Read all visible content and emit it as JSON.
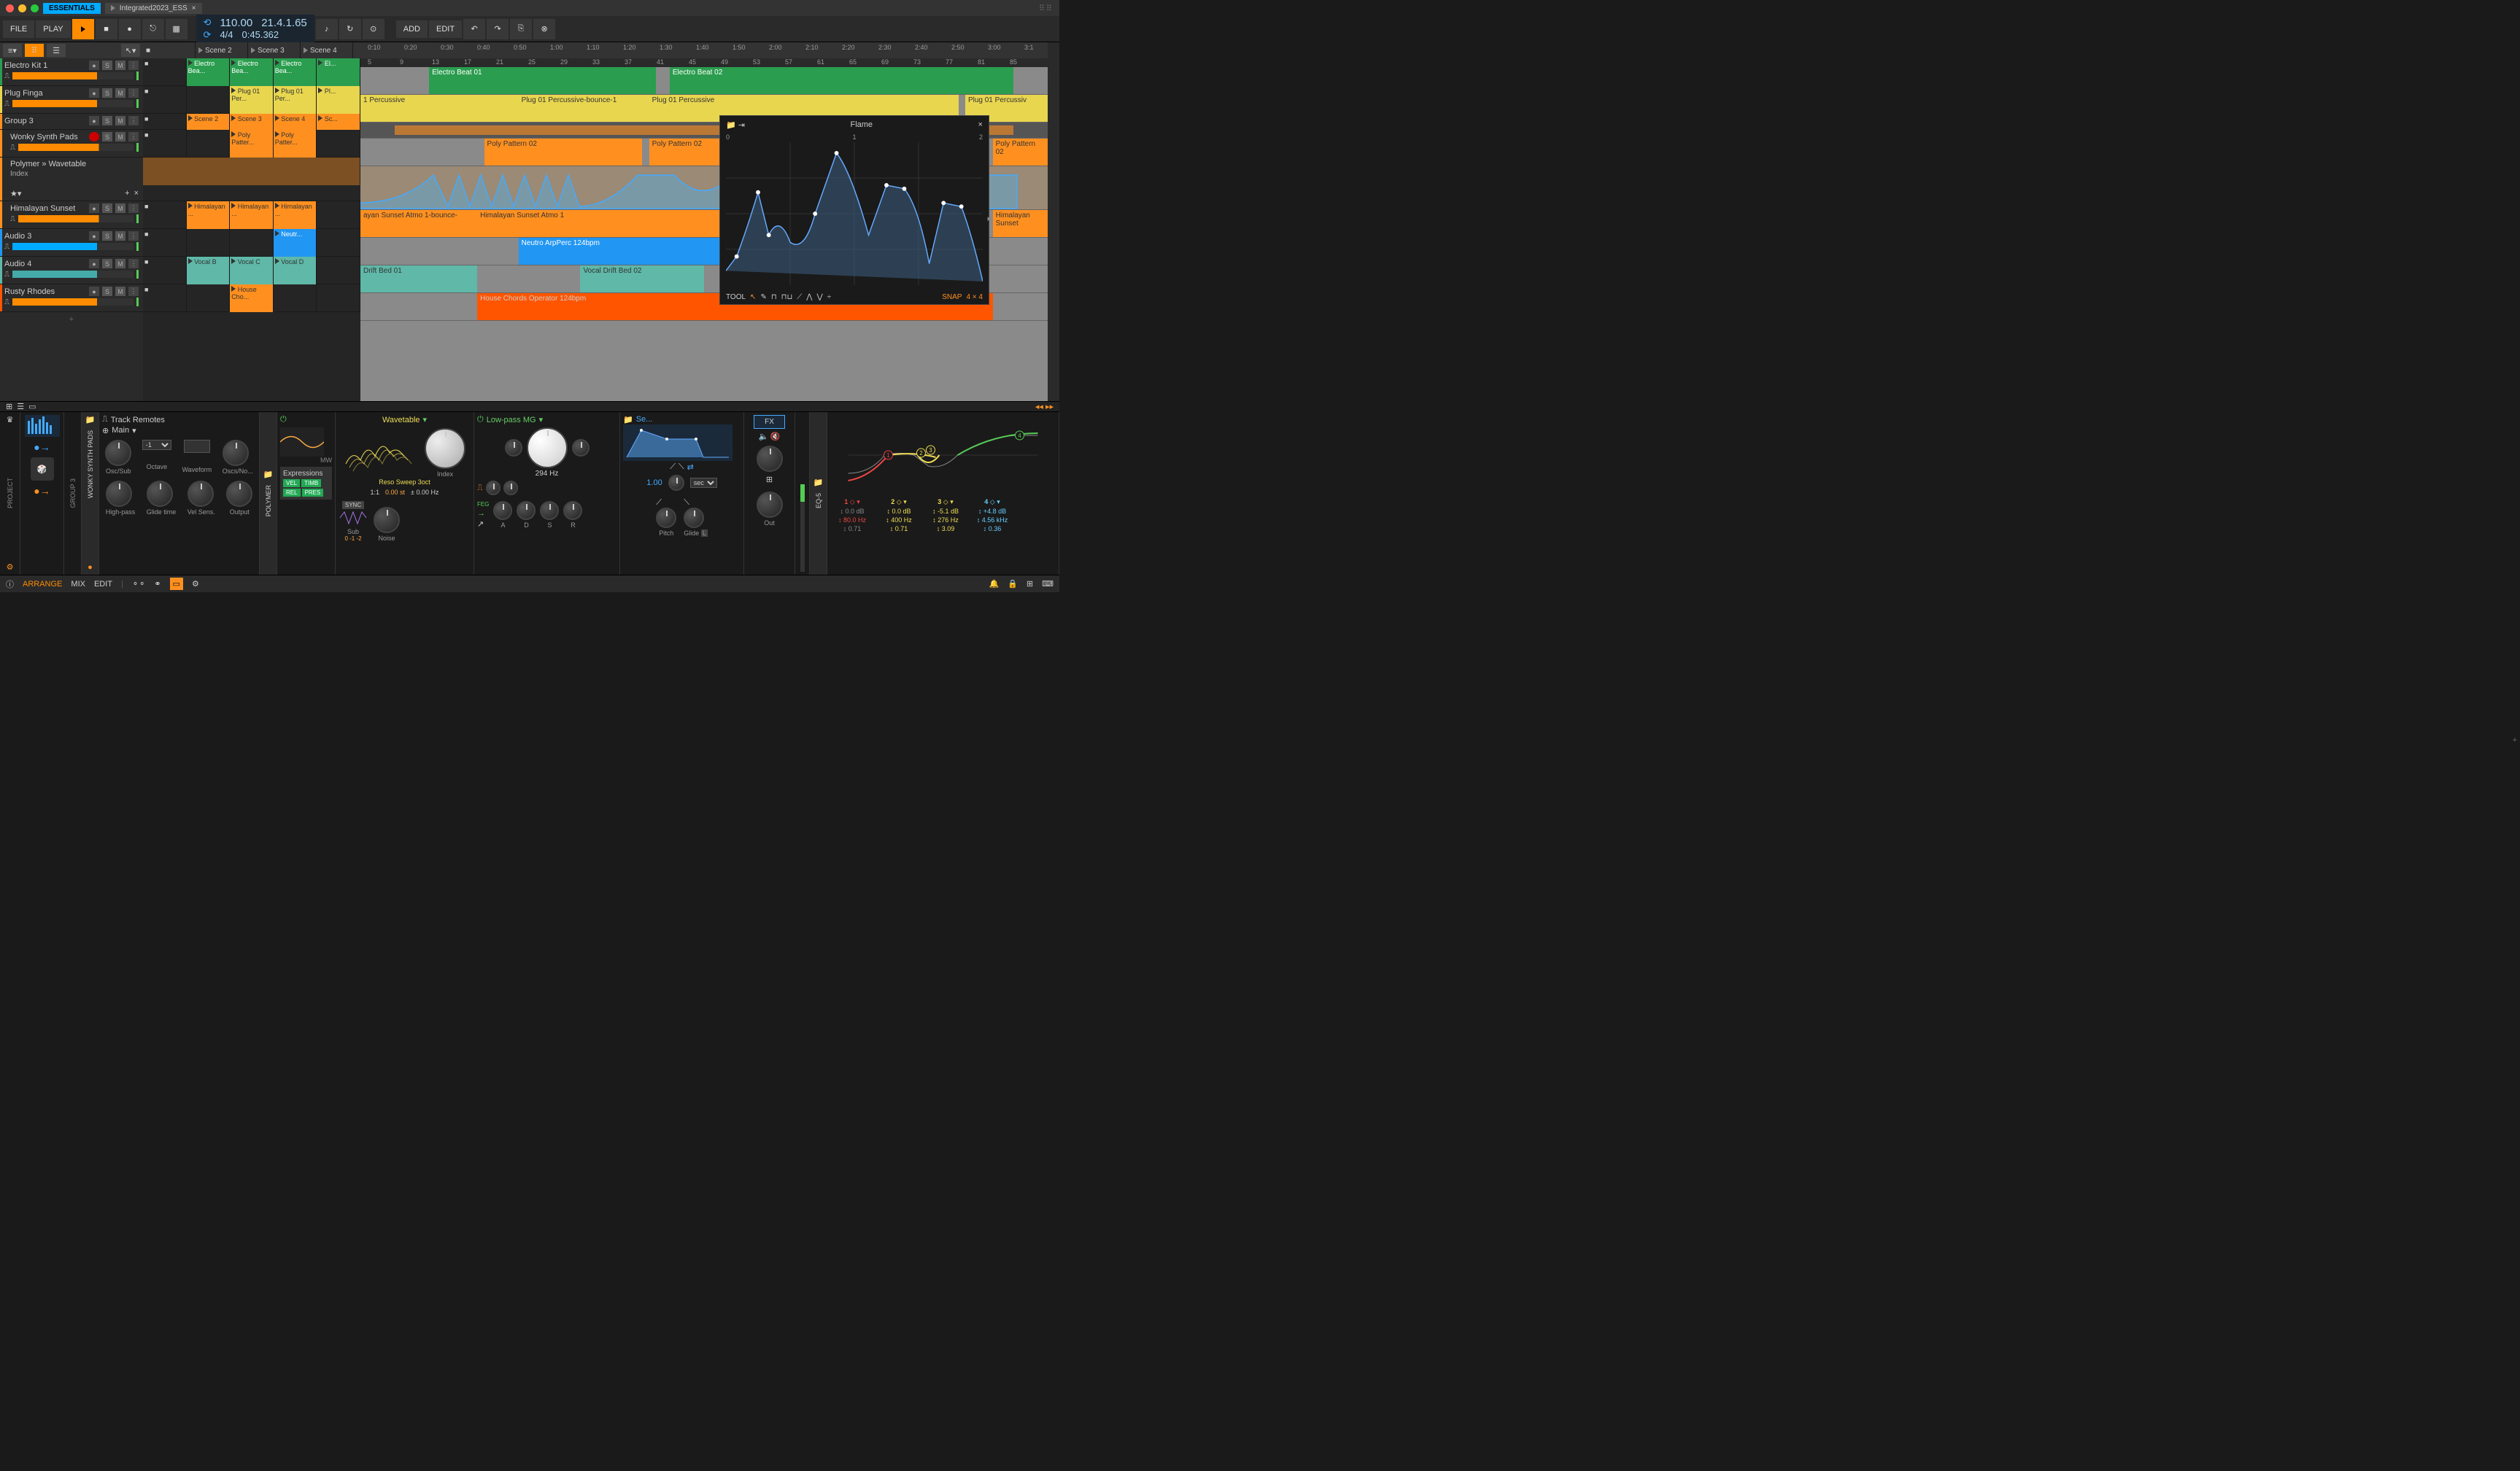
{
  "title_essentials": "ESSENTIALS",
  "doc_name": "Integrated2023_ESS",
  "toolbar": {
    "file": "FILE",
    "play": "PLAY",
    "add": "ADD",
    "edit": "EDIT"
  },
  "transport": {
    "tempo": "110.00",
    "sig": "4/4",
    "pos_bars": "21.4.1.65",
    "pos_time": "0:45.362"
  },
  "timeline_times": [
    "0:10",
    "0:20",
    "0:30",
    "0:40",
    "0:50",
    "1:00",
    "1:10",
    "1:20",
    "1:30",
    "1:40",
    "1:50",
    "2:00",
    "2:10",
    "2:20",
    "2:30",
    "2:40",
    "2:50",
    "3:00",
    "3:1"
  ],
  "timeline_bars": [
    "5",
    "9",
    "13",
    "17",
    "21",
    "25",
    "29",
    "33",
    "37",
    "41",
    "45",
    "49",
    "53",
    "57",
    "61",
    "65",
    "69",
    "73",
    "77",
    "81",
    "85"
  ],
  "scenes": [
    "Scene 2",
    "Scene 3",
    "Scene 4"
  ],
  "tracks": [
    {
      "name": "Electro Kit 1",
      "color": "#2a9d4f",
      "clips": [
        "Electro Bea...",
        "Electro Bea...",
        "Electro Bea...",
        "El..."
      ],
      "arr": [
        {
          "l": 10,
          "w": 33,
          "t": "Electro Beat 01"
        },
        {
          "l": 45,
          "w": 50,
          "t": "Electro Beat 02"
        }
      ]
    },
    {
      "name": "Plug Finga",
      "color": "#e8d64f",
      "clips": [
        "",
        "Plug 01 Per...",
        "Plug 01 Per...",
        "Pl..."
      ],
      "arr": [
        {
          "l": 0,
          "w": 23,
          "t": "1 Percussive"
        },
        {
          "l": 23,
          "w": 19,
          "t": "Plug 01 Percussive-bounce-1"
        },
        {
          "l": 42,
          "w": 45,
          "t": "Plug 01 Percussive"
        },
        {
          "l": 88,
          "w": 12,
          "t": "Plug 01 Percussiv"
        }
      ]
    },
    {
      "name": "Group 3",
      "color": "#ff9020",
      "group": true,
      "clips": [
        "Scene 2",
        "Scene 3",
        "Scene 4",
        "Sc..."
      ]
    },
    {
      "name": "Wonky Synth Pads",
      "color": "#ff9020",
      "nested": true,
      "clips": [
        "",
        "Poly Patter...",
        "Poly Patter...",
        ""
      ],
      "arr": [
        {
          "l": 18,
          "w": 23,
          "t": "Poly Pattern 02"
        },
        {
          "l": 42,
          "w": 48,
          "t": "Poly Pattern 02"
        },
        {
          "l": 92,
          "w": 8,
          "t": "Poly Pattern 02"
        }
      ]
    },
    {
      "name": "Polymer » Wavetable",
      "sub": "Index",
      "color": "#ff9020",
      "nested": true,
      "auto": true
    },
    {
      "name": "Himalayan Sunset",
      "color": "#ff9020",
      "nested": true,
      "clips": [
        "Himalayan ...",
        "Himalayan ...",
        "Himalayan ...",
        ""
      ],
      "arr": [
        {
          "l": 0,
          "w": 17,
          "t": "ayan Sunset Atmo 1-bounce-"
        },
        {
          "l": 17,
          "w": 40,
          "t": "Himalayan Sunset Atmo 1"
        },
        {
          "l": 92,
          "w": 8,
          "t": "Himalayan Sunset"
        }
      ]
    },
    {
      "name": "Audio 3",
      "color": "#2196f3",
      "clips": [
        "",
        "",
        "Neutr...",
        ""
      ],
      "arr": [
        {
          "l": 23,
          "w": 32,
          "t": "Neutro ArpPerc 124bpm"
        }
      ]
    },
    {
      "name": "Audio 4",
      "color": "#5fb8a8",
      "clips": [
        "Vocal B",
        "Vocal C",
        "Vocal D",
        ""
      ],
      "arr": [
        {
          "l": 0,
          "w": 17,
          "t": "Drift Bed 01"
        },
        {
          "l": 32,
          "w": 18,
          "t": "Vocal Drift Bed 02"
        }
      ]
    },
    {
      "name": "Rusty Rhodes",
      "color": "#ff5500",
      "clips": [
        "",
        "House Cho...",
        "",
        ""
      ],
      "arr": [
        {
          "l": 17,
          "w": 75,
          "t": "House Chords Operator 124bpm"
        }
      ]
    }
  ],
  "popup": {
    "title": "Flame",
    "tool": "TOOL",
    "snap": "SNAP",
    "snap_val": "4 × 4",
    "ruler": [
      "0",
      "1",
      "2"
    ]
  },
  "track_remotes": {
    "title": "Track Remotes",
    "dropdown": "Main",
    "sub": "-1",
    "knobs": [
      "Osc/Sub",
      "Octave",
      "Waveform",
      "Oscs/No..."
    ],
    "knobs2": [
      "High-pass",
      "Glide time",
      "Vel Sens.",
      "Output"
    ]
  },
  "polymer": {
    "name": "POLYMER",
    "mw": "MW",
    "exp_title": "Expressions",
    "exp": [
      "VEL",
      "TIMB",
      "REL",
      "PRES"
    ],
    "wavetable": "Wavetable",
    "preset": "Reso Sweep 3oct",
    "index": "Index",
    "ratio": "1:1",
    "fine": "0.00 st",
    "pitch": "± 0.00 Hz",
    "sync": "SYNC",
    "sub": "Sub",
    "subvals": "0  -1  -2",
    "noise": "Noise"
  },
  "filter": {
    "name": "Low-pass MG",
    "freq": "294 Hz",
    "feg": "FEG",
    "env": [
      "A",
      "D",
      "S",
      "R"
    ],
    "time": "1.00",
    "sec": "sec",
    "pitch": "Pitch",
    "glide": "Glide",
    "l": "L",
    "fx": "FX",
    "out": "Out",
    "se": "Se..."
  },
  "eq": {
    "name": "EQ-5",
    "bands": [
      {
        "n": "1",
        "gain": "0.0 dB",
        "freq": "80.0 Hz",
        "q": "0.71",
        "gc": "#888",
        "fc": "#e44",
        "qc": "#888"
      },
      {
        "n": "2",
        "gain": "0.0 dB",
        "freq": "400 Hz",
        "q": "0.71",
        "gc": "#ed5",
        "fc": "#ed5",
        "qc": "#ed5"
      },
      {
        "n": "3",
        "gain": "-5.1 dB",
        "freq": "276 Hz",
        "q": "3.09",
        "gc": "#ed5",
        "fc": "#ed5",
        "qc": "#ed5"
      },
      {
        "n": "4",
        "gain": "+4.8 dB",
        "freq": "4.56 kHz",
        "q": "0.36",
        "gc": "#6cf",
        "fc": "#6cf",
        "qc": "#6cf"
      }
    ]
  },
  "nav": {
    "group": "GROUP 3",
    "track": "WONKY SYNTH PADS",
    "project": "PROJECT"
  },
  "status": {
    "arrange": "ARRANGE",
    "mix": "MIX",
    "edit": "EDIT"
  }
}
